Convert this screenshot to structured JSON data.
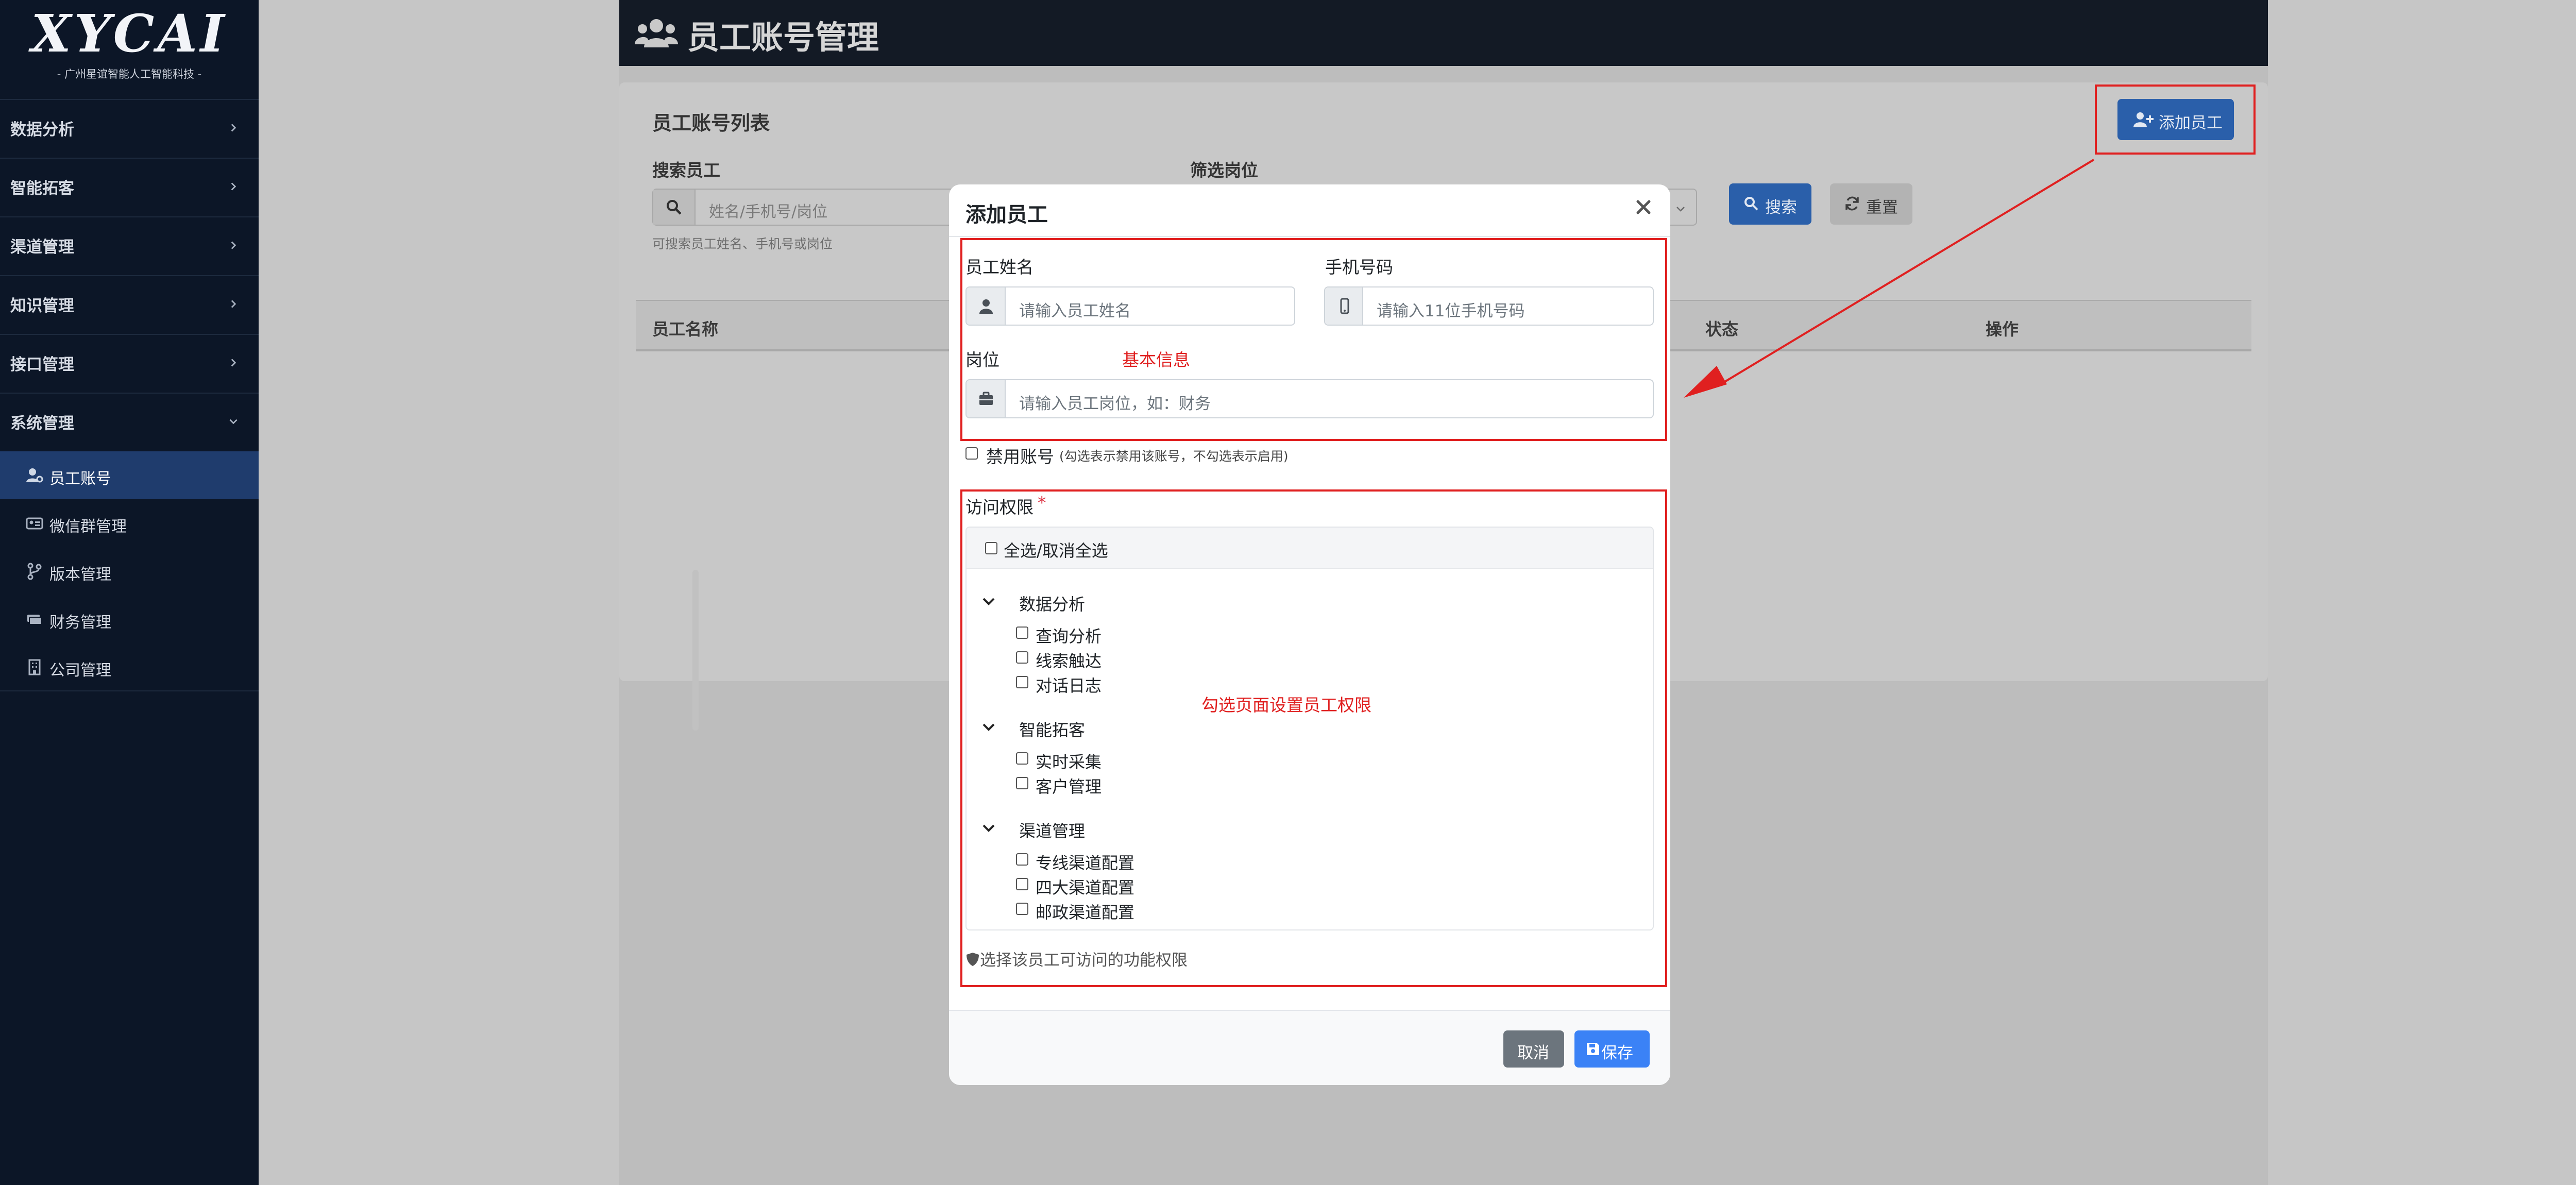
{
  "sidebar": {
    "logo_text": "XYCAI",
    "logo_subtitle": "- 广州星谊智能人工智能科技 -",
    "menu": [
      {
        "label": "数据分析",
        "icon": "chevron-right-icon"
      },
      {
        "label": "智能拓客",
        "icon": "chevron-right-icon"
      },
      {
        "label": "渠道管理",
        "icon": "chevron-right-icon"
      },
      {
        "label": "知识管理",
        "icon": "chevron-right-icon"
      },
      {
        "label": "接口管理",
        "icon": "chevron-right-icon"
      },
      {
        "label": "系统管理",
        "icon": "chevron-down-icon",
        "expanded": true
      }
    ],
    "submenu": [
      {
        "label": "员工账号",
        "icon": "user-gear-icon",
        "active": true
      },
      {
        "label": "微信群管理",
        "icon": "id-card-icon"
      },
      {
        "label": "版本管理",
        "icon": "code-branch-icon"
      },
      {
        "label": "财务管理",
        "icon": "money-bill-icon"
      },
      {
        "label": "公司管理",
        "icon": "building-icon"
      }
    ]
  },
  "header": {
    "title": "员工账号管理",
    "icon": "users-icon"
  },
  "page": {
    "list_title": "员工账号列表",
    "add_button": "添加员工",
    "search": {
      "label": "搜索员工",
      "placeholder": "姓名/手机号/岗位",
      "hint": "可搜索员工姓名、手机号或岗位"
    },
    "filter": {
      "label": "筛选岗位"
    },
    "search_button": "搜索",
    "reset_button": "重置",
    "table_headers": [
      "员工名称",
      "状态",
      "操作"
    ]
  },
  "modal": {
    "title": "添加员工",
    "fields": {
      "name": {
        "label": "员工姓名",
        "placeholder": "请输入员工姓名"
      },
      "phone": {
        "label": "手机号码",
        "placeholder": "请输入11位手机号码"
      },
      "position": {
        "label": "岗位",
        "placeholder": "请输入员工岗位，如：财务"
      }
    },
    "disable": {
      "label": "禁用账号",
      "hint": "(勾选表示禁用该账号，不勾选表示启用)",
      "checked": false
    },
    "permissions": {
      "label": "访问权限",
      "required_mark": "*",
      "select_all": "全选/取消全选",
      "groups": [
        {
          "label": "数据分析",
          "items": [
            "查询分析",
            "线索触达",
            "对话日志"
          ]
        },
        {
          "label": "智能拓客",
          "items": [
            "实时采集",
            "客户管理"
          ]
        },
        {
          "label": "渠道管理",
          "items": [
            "专线渠道配置",
            "四大渠道配置",
            "邮政渠道配置"
          ]
        }
      ],
      "hint": "选择该员工可访问的功能权限"
    },
    "cancel_button": "取消",
    "save_button": "保存"
  },
  "annotations": {
    "basic_info": "基本信息",
    "permissions_note": "勾选页面设置员工权限"
  },
  "colors": {
    "sidebar_bg": "#0c1627",
    "active_item": "#1f3c6d",
    "primary": "#3b82f6",
    "annotation_red": "#e02020"
  }
}
